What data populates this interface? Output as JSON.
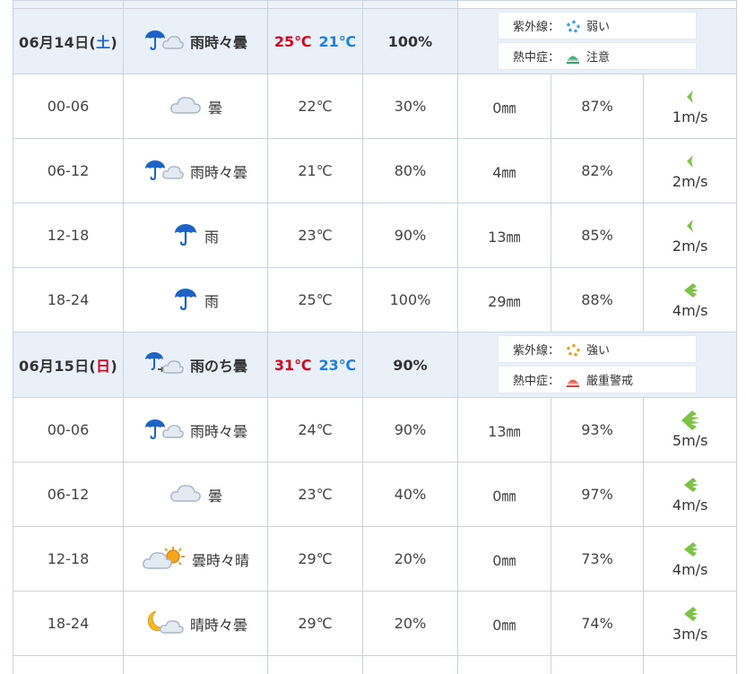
{
  "days": [
    {
      "date": "06月14日(",
      "dow": "土",
      "close": ")",
      "dow_color": "#1a66cc",
      "weather_icon": "rain-sometimes-cloudy-icon",
      "weather": "雨時々曇",
      "temp_high": "25℃",
      "temp_low": "21℃",
      "precip_prob": "100%",
      "uv_label": "紫外線：",
      "uv_icon": "uv-weak-icon",
      "uv_value": "弱い",
      "heat_label": "熱中症：",
      "heat_icon": "heat-caution-icon",
      "heat_value": "注意",
      "rows": [
        {
          "time": "00-06",
          "icon": "cloud-icon",
          "weather": "曇",
          "temp": "22℃",
          "prob": "30%",
          "rain": "0㎜",
          "humidity": "87%",
          "wind_icon": "wind-arrow-icon",
          "wind_level": "1",
          "wind": "1m/s"
        },
        {
          "time": "06-12",
          "icon": "rain-sometimes-cloudy-icon",
          "weather": "雨時々曇",
          "temp": "21℃",
          "prob": "80%",
          "rain": "4㎜",
          "humidity": "82%",
          "wind_icon": "wind-arrow-icon",
          "wind_level": "1",
          "wind": "2m/s"
        },
        {
          "time": "12-18",
          "icon": "umbrella-icon",
          "weather": "雨",
          "temp": "23℃",
          "prob": "90%",
          "rain": "13㎜",
          "humidity": "85%",
          "wind_icon": "wind-arrow-icon",
          "wind_level": "1",
          "wind": "2m/s"
        },
        {
          "time": "18-24",
          "icon": "umbrella-icon",
          "weather": "雨",
          "temp": "25℃",
          "prob": "100%",
          "rain": "29㎜",
          "humidity": "88%",
          "wind_icon": "wind-arrow-icon",
          "wind_level": "2",
          "wind": "4m/s"
        }
      ]
    },
    {
      "date": "06月15日(",
      "dow": "日",
      "close": ")",
      "dow_color": "#e0001b",
      "weather_icon": "rain-then-cloudy-icon",
      "weather": "雨のち曇",
      "temp_high": "31℃",
      "temp_low": "23℃",
      "precip_prob": "90%",
      "uv_label": "紫外線：",
      "uv_icon": "uv-strong-icon",
      "uv_value": "強い",
      "heat_label": "熱中症：",
      "heat_icon": "heat-strict-warning-icon",
      "heat_value": "厳重警戒",
      "rows": [
        {
          "time": "00-06",
          "icon": "rain-sometimes-cloudy-icon",
          "weather": "雨時々曇",
          "temp": "24℃",
          "prob": "90%",
          "rain": "13㎜",
          "humidity": "93%",
          "wind_icon": "wind-arrow-icon",
          "wind_level": "3",
          "wind": "5m/s"
        },
        {
          "time": "06-12",
          "icon": "cloud-icon",
          "weather": "曇",
          "temp": "23℃",
          "prob": "40%",
          "rain": "0㎜",
          "humidity": "97%",
          "wind_icon": "wind-arrow-icon",
          "wind_level": "2",
          "wind": "4m/s"
        },
        {
          "time": "12-18",
          "icon": "cloudy-sometimes-sunny-icon",
          "weather": "曇時々晴",
          "temp": "29℃",
          "prob": "20%",
          "rain": "0㎜",
          "humidity": "73%",
          "wind_icon": "wind-arrow-icon",
          "wind_level": "2",
          "wind": "4m/s"
        },
        {
          "time": "18-24",
          "icon": "moon-cloud-icon",
          "weather": "晴時々曇",
          "temp": "29℃",
          "prob": "20%",
          "rain": "0㎜",
          "humidity": "74%",
          "wind_icon": "wind-arrow-icon",
          "wind_level": "2",
          "wind": "3m/s"
        }
      ]
    }
  ],
  "colors": {
    "header_bg": "#eaf0f8",
    "border": "#c9d3e0",
    "temp_high": "#e0001b",
    "temp_low": "#1a80e6",
    "wind_green": "#7cc243"
  }
}
